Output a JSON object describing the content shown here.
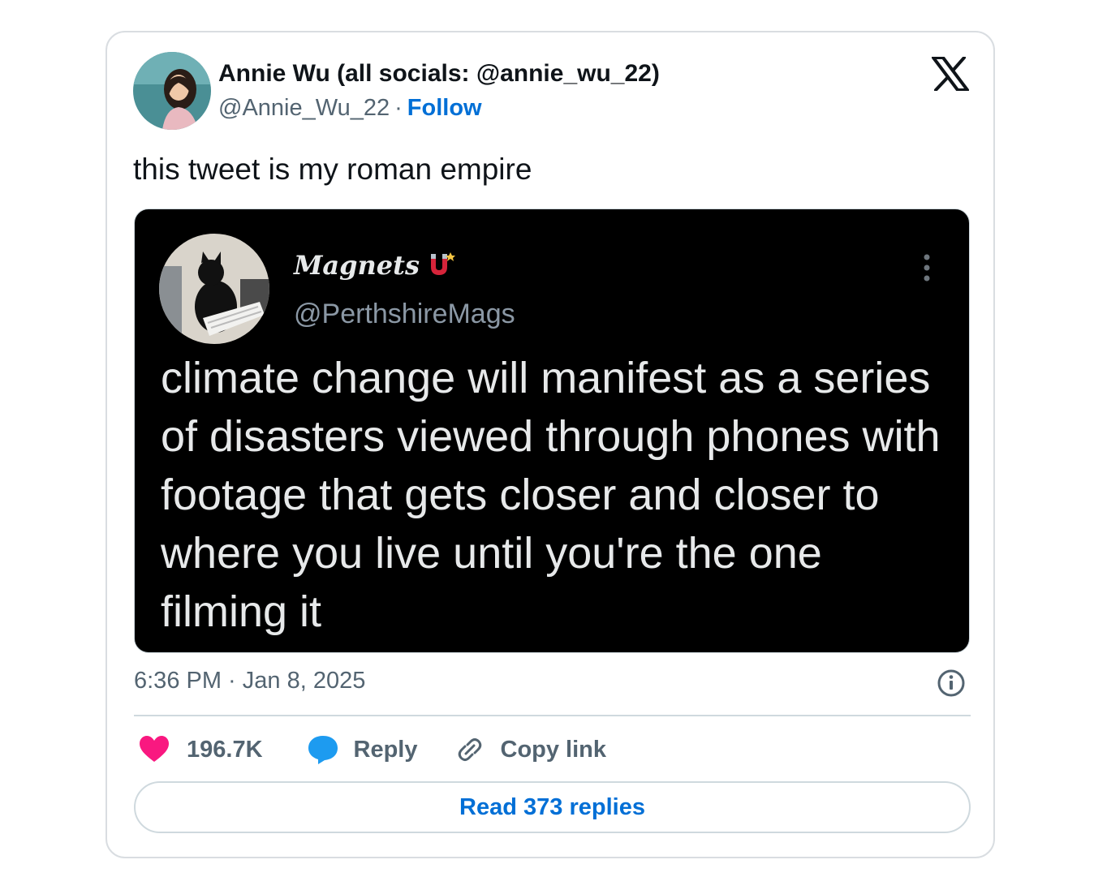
{
  "author": {
    "name": "Annie Wu (all socials: @annie_wu_22)",
    "handle": "@Annie_Wu_22",
    "separator": "·",
    "follow_label": "Follow",
    "avatar_icon": "profile-photo"
  },
  "platform_logo": "x-logo",
  "tweet": {
    "text": "this tweet is my roman empire",
    "timestamp": "6:36 PM · Jan 8, 2025"
  },
  "quoted_screenshot": {
    "name": "Magnets",
    "name_icon": "magnet-emoji",
    "handle": "@PerthshireMags",
    "text": "climate change will manifest as a series of disasters viewed through phones with footage that gets closer and closer to where you live until you're the one filming it",
    "avatar_icon": "black-cat-photo",
    "more_icon": "vertical-ellipsis-icon"
  },
  "actions": {
    "like_count": "196.7K",
    "reply_label": "Reply",
    "copy_link_label": "Copy link",
    "read_replies_label": "Read 373 replies"
  },
  "colors": {
    "like": "#f91880",
    "reply": "#1d9bf0",
    "link_blue": "#006fd6",
    "muted": "#536471",
    "border": "#cfd9de"
  }
}
